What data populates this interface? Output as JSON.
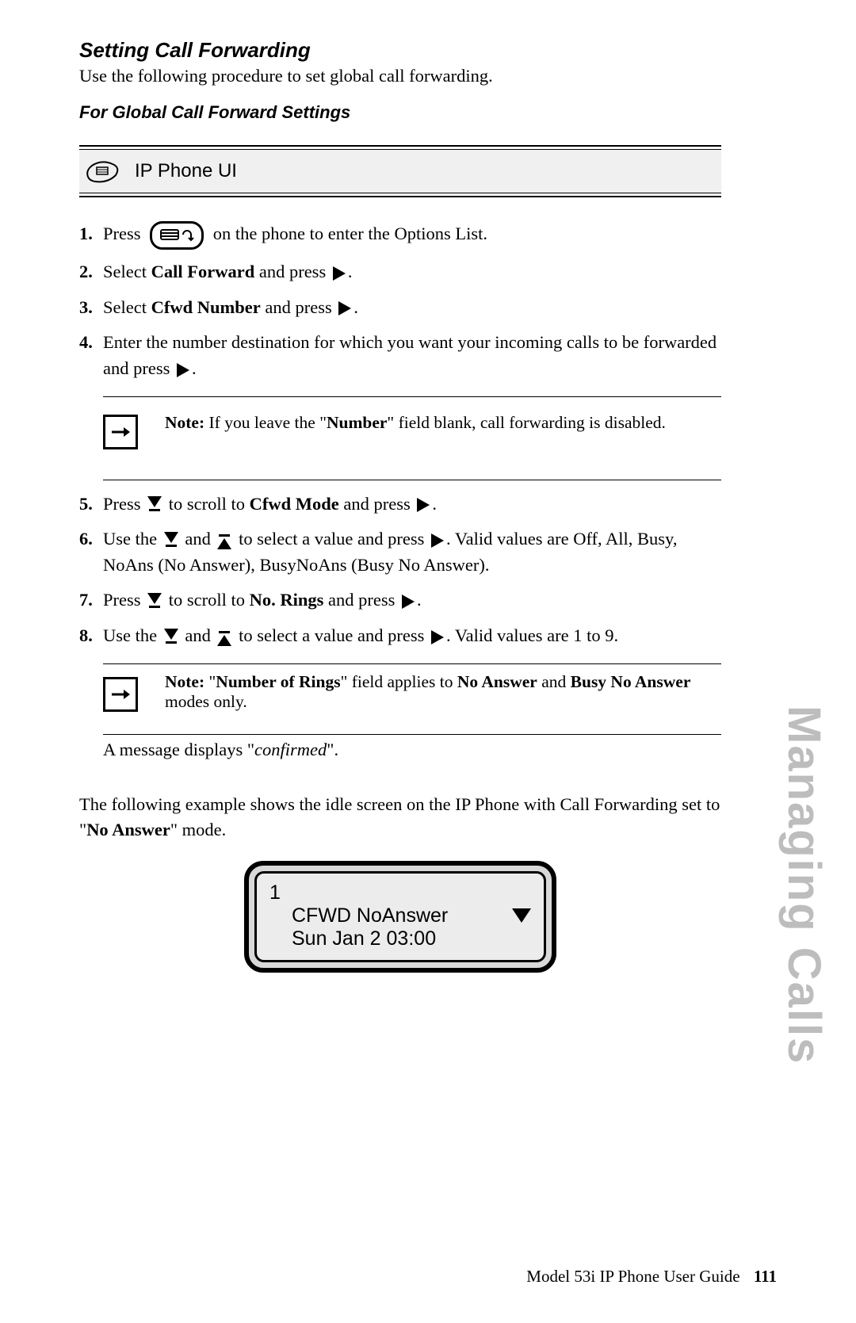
{
  "heading_section": "Setting Call Forwarding",
  "intro": "Use the following procedure to set global call forwarding.",
  "heading_sub": "For Global Call Forward Settings",
  "ui_band_label": "IP Phone UI",
  "steps": {
    "s1_a": "Press ",
    "s1_b": " on the phone to enter the Options List.",
    "s2_a": "Select ",
    "s2_bold": "Call Forward",
    "s2_b": " and press ",
    "s2_c": ".",
    "s3_a": "Select ",
    "s3_bold": "Cfwd Number",
    "s3_b": " and press ",
    "s3_c": ".",
    "s4_a": "Enter the number destination for which you want your incoming calls to be forwarded and press ",
    "s4_b": ".",
    "s5_a": "Press ",
    "s5_b": " to scroll to ",
    "s5_bold": "Cfwd Mode",
    "s5_c": " and press ",
    "s5_d": ".",
    "s6_a": "Use the ",
    "s6_b": " and ",
    "s6_c": " to select a value and press ",
    "s6_d": ". Valid values are Off, All, Busy, NoAns (No Answer), BusyNoAns (Busy No Answer).",
    "s7_a": "Press ",
    "s7_b": " to scroll to ",
    "s7_bold": "No. Rings",
    "s7_c": " and press ",
    "s7_d": ".",
    "s8_a": "Use the ",
    "s8_b": " and ",
    "s8_c": " to select a value and press ",
    "s8_d": ". Valid values are 1 to 9."
  },
  "note1": {
    "label": "Note:",
    "a": " If you leave the \"",
    "bold": "Number",
    "b": "\" field blank, call forwarding is disabled."
  },
  "note2": {
    "label": "Note:",
    "a": " \"",
    "bold1": "Number of Rings",
    "b": "\" field applies to ",
    "bold2": "No Answer",
    "c": " and ",
    "bold3": "Busy No Answer",
    "d": " modes only."
  },
  "confirm_a": "A message displays \"",
  "confirm_it": "confirmed",
  "confirm_b": "\".",
  "example_a": "The following example shows the idle screen on the IP Phone with Call Forwarding set to \"",
  "example_bold": "No Answer",
  "example_b": "\" mode.",
  "screen": {
    "line1": "1",
    "line2": "CFWD NoAnswer",
    "line3": "Sun  Jan 2  03:00"
  },
  "side_tab": "Managing Calls",
  "footer_doc": "Model 53i IP Phone User Guide",
  "footer_page": "111"
}
